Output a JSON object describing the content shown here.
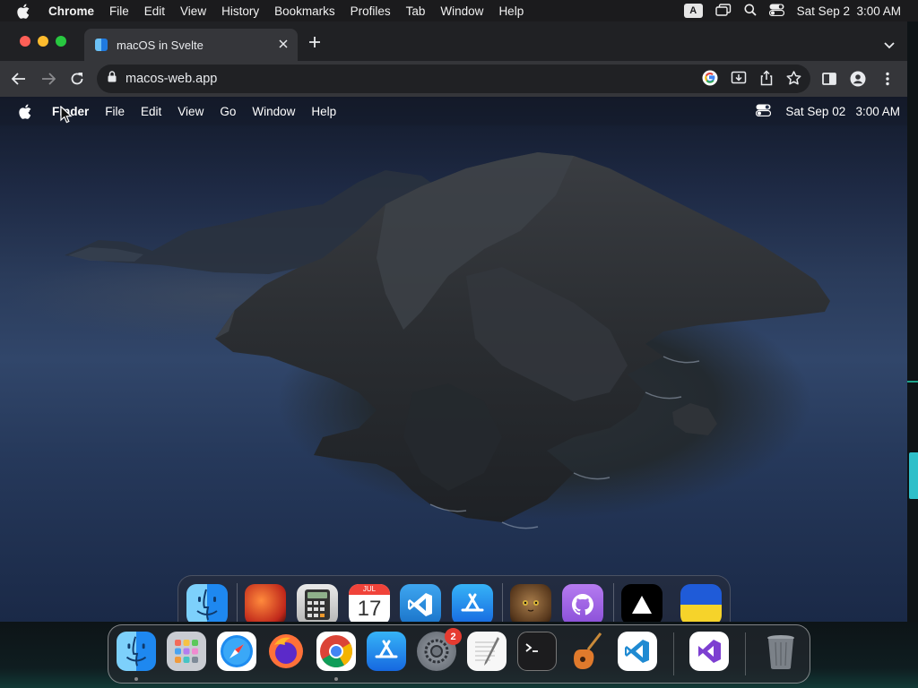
{
  "host_menubar": {
    "app_name": "Chrome",
    "menus": [
      "File",
      "Edit",
      "View",
      "History",
      "Bookmarks",
      "Profiles",
      "Tab",
      "Window",
      "Help"
    ],
    "input_badge": "A",
    "datetime": "Sat Sep 2  3:00 AM"
  },
  "browser": {
    "tab_title": "macOS in Svelte",
    "url": "macos-web.app"
  },
  "inner_menubar": {
    "app_name": "Finder",
    "menus": [
      "File",
      "Edit",
      "View",
      "Go",
      "Window",
      "Help"
    ],
    "datetime": "Sat Sep 02   3:00 AM"
  },
  "inner_dock": {
    "calendar_month": "JUL",
    "calendar_day": "17",
    "items": [
      {
        "name": "Finder",
        "icon": "finder-icon",
        "running": true
      },
      {
        "name": "Wallpapers",
        "icon": "wallpapers-icon",
        "running": false
      },
      {
        "name": "Calculator",
        "icon": "calculator-icon",
        "running": false
      },
      {
        "name": "Calendar",
        "icon": "calendar-icon",
        "running": false
      },
      {
        "name": "VSCode",
        "icon": "vscode-icon",
        "running": false
      },
      {
        "name": "App Store",
        "icon": "app-store-icon",
        "running": false
      },
      {
        "name": "Purus Twitter",
        "icon": "cat-icon",
        "running": false
      },
      {
        "name": "GitHub",
        "icon": "github-icon",
        "running": true
      },
      {
        "name": "Vercel",
        "icon": "vercel-icon",
        "running": true
      },
      {
        "name": "Ukraine",
        "icon": "ukraine-flag-icon",
        "running": true
      }
    ]
  },
  "host_dock": {
    "settings_badge": "2",
    "items": [
      {
        "name": "Finder",
        "icon": "finder-icon",
        "running": true
      },
      {
        "name": "Launchpad",
        "icon": "launchpad-icon",
        "running": false
      },
      {
        "name": "Safari",
        "icon": "safari-icon",
        "running": false
      },
      {
        "name": "Firefox",
        "icon": "firefox-icon",
        "running": false
      },
      {
        "name": "Chrome",
        "icon": "chrome-icon",
        "running": true
      },
      {
        "name": "App Store",
        "icon": "app-store-icon",
        "running": false
      },
      {
        "name": "System Settings",
        "icon": "system-settings-icon",
        "running": false
      },
      {
        "name": "TextEdit",
        "icon": "textedit-icon",
        "running": false
      },
      {
        "name": "Terminal",
        "icon": "terminal-icon",
        "running": false
      },
      {
        "name": "GarageBand",
        "icon": "garageband-icon",
        "running": false
      },
      {
        "name": "VS Code",
        "icon": "vscode-icon",
        "running": false
      },
      {
        "name": "Visual Studio",
        "icon": "visual-studio-icon",
        "running": false
      },
      {
        "name": "Trash",
        "icon": "trash-icon",
        "running": false
      }
    ]
  },
  "colors": {
    "host_menubar_bg": "#1b1b1d",
    "chrome_toolbar": "#35363a",
    "chrome_frame": "#202124",
    "wallpaper_sky": "#2a3b5a"
  }
}
